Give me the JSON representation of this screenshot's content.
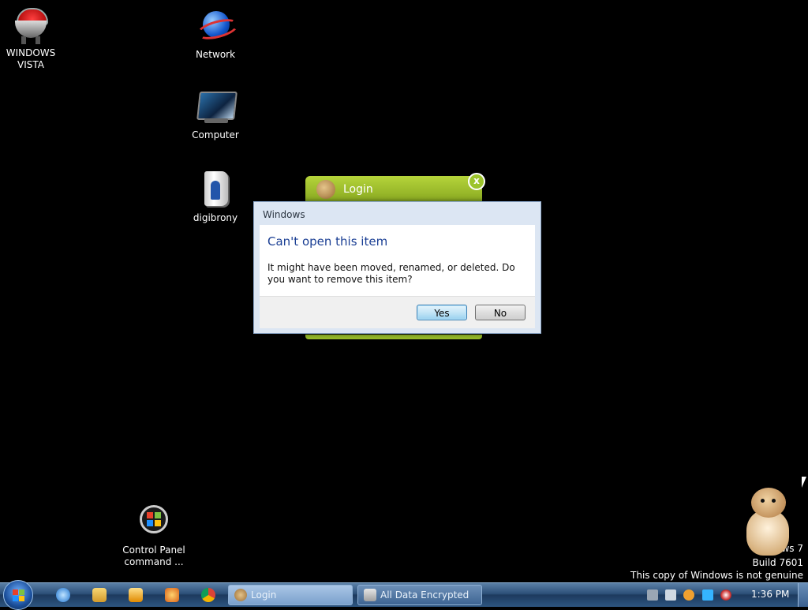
{
  "desktop": {
    "icons": [
      {
        "label": "WINDOWS\nVISTA",
        "icon": "robot-capsule-icon"
      },
      {
        "label": "Network",
        "icon": "globe-icon"
      },
      {
        "label": "Computer",
        "icon": "monitor-icon"
      },
      {
        "label": "digibrony",
        "icon": "book-figure-icon"
      },
      {
        "label": "Control Panel\ncommand ...",
        "icon": "windows-orb-icon"
      }
    ]
  },
  "login_window": {
    "title": "Login",
    "close_glyph": "x"
  },
  "dialog": {
    "title": "Windows",
    "heading": "Can't open this item",
    "message": "It might have been moved, renamed, or deleted. Do you want to remove this item?",
    "yes_label": "Yes",
    "no_label": "No"
  },
  "watermark": {
    "line1": "ws 7",
    "line2": "Build 7601",
    "line3": "This copy of Windows is not genuine"
  },
  "taskbar": {
    "tasks": [
      {
        "label": "Login",
        "active": true
      },
      {
        "label": "All Data Encrypted",
        "active": false
      }
    ],
    "clock": "1:36 PM"
  }
}
